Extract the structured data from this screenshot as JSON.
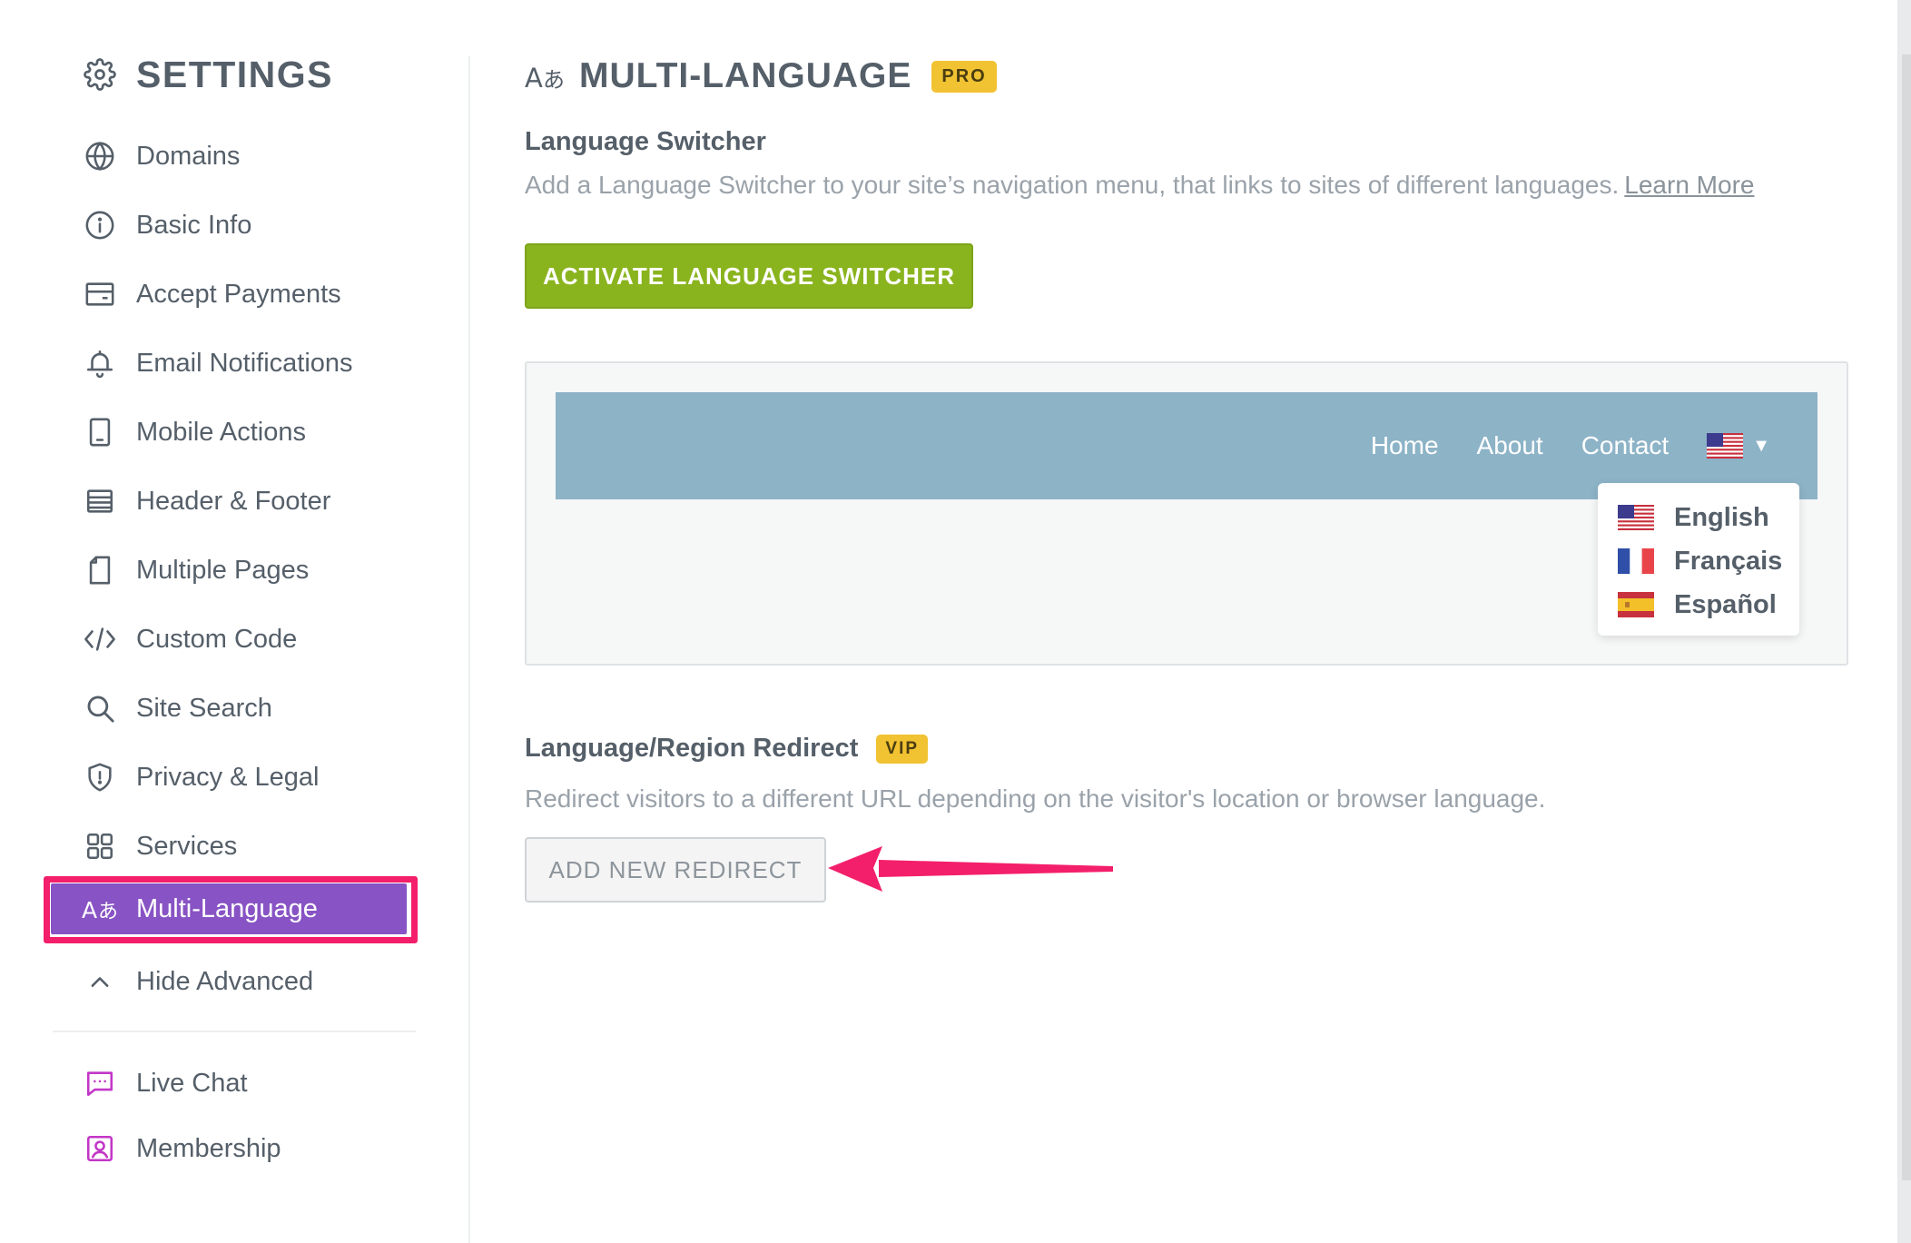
{
  "sidebar": {
    "title": "SETTINGS",
    "title_icon": "gear-icon",
    "items": [
      {
        "label": "Domains",
        "icon": "globe-icon"
      },
      {
        "label": "Basic Info",
        "icon": "info-icon"
      },
      {
        "label": "Accept Payments",
        "icon": "wallet-icon"
      },
      {
        "label": "Email Notifications",
        "icon": "bell-icon"
      },
      {
        "label": "Mobile Actions",
        "icon": "mobile-icon"
      },
      {
        "label": "Header & Footer",
        "icon": "layout-icon"
      },
      {
        "label": "Multiple Pages",
        "icon": "pages-icon"
      },
      {
        "label": "Custom Code",
        "icon": "code-icon"
      },
      {
        "label": "Site Search",
        "icon": "search-icon"
      },
      {
        "label": "Privacy & Legal",
        "icon": "shield-icon"
      },
      {
        "label": "Services",
        "icon": "grid-icon"
      },
      {
        "label": "Multi-Language",
        "icon": "translate-icon",
        "active": true
      },
      {
        "label": "Hide Advanced",
        "icon": "chevron-up-icon"
      }
    ],
    "apps": [
      {
        "label": "Live Chat",
        "icon": "chat-icon"
      },
      {
        "label": "Membership",
        "icon": "member-icon"
      }
    ],
    "active_color": "#8853c4",
    "highlight_color": "#f31f6a",
    "app_icon_color": "#c236c7"
  },
  "main": {
    "title": "MULTI-LANGUAGE",
    "title_icon": "translate-icon",
    "title_badge": "PRO",
    "switcher": {
      "title": "Language Switcher",
      "description": "Add a Language Switcher to your site’s navigation menu, that links to sites of different languages.",
      "learn_more": "Learn More",
      "activate_button": "ACTIVATE LANGUAGE SWITCHER",
      "button_color": "#8ab41e"
    },
    "preview": {
      "nav_links": [
        "Home",
        "About",
        "Contact"
      ],
      "nav_color": "#8db3c7",
      "current_flag": "us-flag-icon",
      "languages": [
        {
          "name": "English",
          "flag": "us-flag-icon"
        },
        {
          "name": "Français",
          "flag": "fr-flag-icon"
        },
        {
          "name": "Español",
          "flag": "es-flag-icon"
        }
      ]
    },
    "redirect": {
      "title": "Language/Region Redirect",
      "badge": "VIP",
      "description": "Redirect visitors to a different URL depending on the visitor's location or browser language.",
      "add_button": "ADD NEW REDIRECT",
      "arrow_color": "#f31f6a"
    }
  }
}
